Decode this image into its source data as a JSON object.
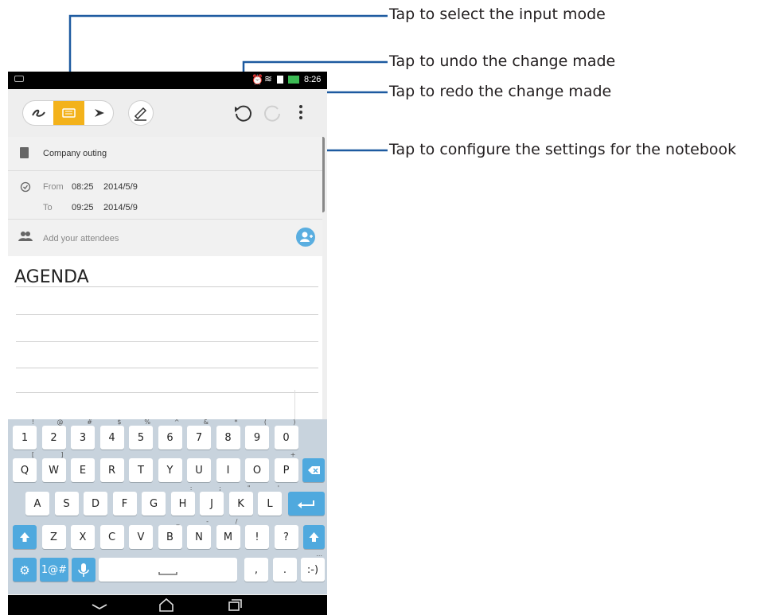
{
  "callouts": [
    "Tap to select the input mode",
    "Tap to undo the change made",
    "Tap to redo the change made",
    "Tap to configure the settings for the notebook"
  ],
  "status_bar": {
    "time": "8:26"
  },
  "toolbar": {
    "icons": [
      "handwriting-icon",
      "keyboard-icon",
      "draw-icon",
      "pen-style-icon",
      "undo-icon",
      "redo-icon",
      "more-options-icon"
    ]
  },
  "event": {
    "title": "Company outing",
    "from_label": "From",
    "from_time": "08:25",
    "from_date": "2014/5/9",
    "to_label": "To",
    "to_time": "09:25",
    "to_date": "2014/5/9",
    "attendees_placeholder": "Add your attendees"
  },
  "note": {
    "text": "AGENDA"
  },
  "keyboard": {
    "row1": [
      [
        "1",
        "!"
      ],
      [
        "2",
        "@"
      ],
      [
        "3",
        "#"
      ],
      [
        "4",
        "$"
      ],
      [
        "5",
        "%"
      ],
      [
        "6",
        "^"
      ],
      [
        "7",
        "&"
      ],
      [
        "8",
        "*"
      ],
      [
        "9",
        "("
      ],
      [
        "0",
        ")"
      ]
    ],
    "row2": [
      [
        "Q",
        "["
      ],
      [
        "W",
        "]"
      ],
      [
        "E",
        ""
      ],
      [
        "R",
        ""
      ],
      [
        "T",
        ""
      ],
      [
        "Y",
        ""
      ],
      [
        "U",
        ""
      ],
      [
        "I",
        ""
      ],
      [
        "O",
        ""
      ],
      [
        "P",
        "+"
      ]
    ],
    "row3": [
      [
        "A",
        ""
      ],
      [
        "S",
        ""
      ],
      [
        "D",
        ""
      ],
      [
        "F",
        ""
      ],
      [
        "G",
        ""
      ],
      [
        "H",
        ":"
      ],
      [
        "J",
        ";"
      ],
      [
        "K",
        "\""
      ],
      [
        "L",
        "'"
      ]
    ],
    "row4": [
      [
        "Z",
        ""
      ],
      [
        "X",
        ""
      ],
      [
        "C",
        ""
      ],
      [
        "V",
        ""
      ],
      [
        "B",
        "_"
      ],
      [
        "N",
        "-"
      ],
      [
        "M",
        "/"
      ],
      [
        "!",
        ""
      ],
      [
        "?",
        ""
      ]
    ],
    "symbols_label": "1@#",
    "comma": ",",
    "period": ".",
    "smiley": ":-)",
    "smiley_sub": "...",
    "accent_color": "#4fa9de"
  }
}
